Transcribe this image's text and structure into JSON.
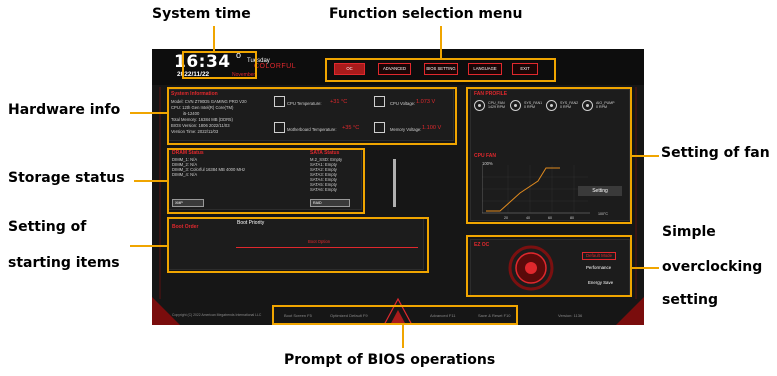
{
  "callouts": {
    "system_time": "System time",
    "function_menu": "Function selection menu",
    "hardware_info": "Hardware info",
    "storage_status": "Storage status",
    "setting_of_starting_items_1": "Setting of",
    "setting_of_starting_items_2": "starting items",
    "setting_of_fan": "Setting of fan",
    "simple_oc_1": "Simple",
    "simple_oc_2": "overclocking",
    "simple_oc_3": "setting",
    "bios_prompt": "Prompt of BIOS operations"
  },
  "clock": {
    "time": "16:34",
    "day": "Tuesday",
    "date": "2022/11/22",
    "month": "November"
  },
  "logo": "COLORFUL",
  "menu": [
    {
      "label": "OC",
      "active": true
    },
    {
      "label": "ADVANCED",
      "active": false
    },
    {
      "label": "BIOS SETTING",
      "active": false
    },
    {
      "label": "LANGUAGE",
      "active": false
    },
    {
      "label": "EXIT",
      "active": false
    }
  ],
  "system_info": {
    "title": "System Information",
    "model": "Model: CVN Z790D5 GAMING PRO V20",
    "cpu": "CPU: 12th Gen Intel(R) Core(TM)",
    "cpu_model": "i5-12400",
    "total_memory": "Total Memory: 16384 MB (DDR5)",
    "bios_version": "BIOS Version: 1806 2022/11/03",
    "version_time": "Version Time: 2022/11/03",
    "cpu_temp_label": "CPU Temperature:",
    "cpu_temp_value": "+31 °C",
    "cpu_voltage_label": "CPU Voltage:",
    "cpu_voltage_value": "1.073 V",
    "mb_temp_label": "Motherboard Temperature:",
    "mb_temp_value": "+35 °C",
    "mem_voltage_label": "Memory Voltage:",
    "mem_voltage_value": "1.100 V"
  },
  "dram": {
    "title": "DRAM Status",
    "slots": [
      "DIMM_1: N/A",
      "DIMM_2: N/A",
      "DIMM_3: Colorful 16384 MB 4000 MHz",
      "DIMM_4: N/A"
    ],
    "button": "XMP"
  },
  "sata": {
    "title": "SATA Status",
    "ports": [
      "M.2_SSD: Empty",
      "SATA1: Empty",
      "SATA2: Empty",
      "SATA3: Empty",
      "SATA4: Empty",
      "SATA5: Empty",
      "SATA6: Empty"
    ],
    "button": "RAID"
  },
  "boot": {
    "title": "Boot Order",
    "priority_label": "Boot Priority",
    "device": "Boot Option"
  },
  "fan": {
    "title": "FAN PROFILE",
    "fans": [
      {
        "name": "CPU_FAN",
        "speed": "1429 RPM"
      },
      {
        "name": "SYS_FAN1",
        "speed": "0 RPM"
      },
      {
        "name": "SYS_FAN2",
        "speed": "0 RPM"
      },
      {
        "name": "AIO_PUMP",
        "speed": "0 RPM"
      }
    ],
    "curve_title": "CPU FAN",
    "y_max": "100%",
    "x_ticks": [
      "20",
      "40",
      "60",
      "80"
    ],
    "x_unit": "100°C",
    "setting_button": "Setting"
  },
  "oc": {
    "title": "EZ OC",
    "options": [
      "Default Mode",
      "Performance",
      "Energy Save"
    ],
    "selected": "Default Mode"
  },
  "footer": {
    "copyright": "Copyright (C) 2022 American Megatrends International LLC",
    "items": [
      "Boot Screen F5",
      "Optimized Default F9",
      "Advanced F11",
      "Save & Reset F10"
    ],
    "version": "Version: 1136"
  },
  "colors": {
    "accent": "#e0282d",
    "highlight": "#f0a500",
    "bg": "#161616"
  }
}
